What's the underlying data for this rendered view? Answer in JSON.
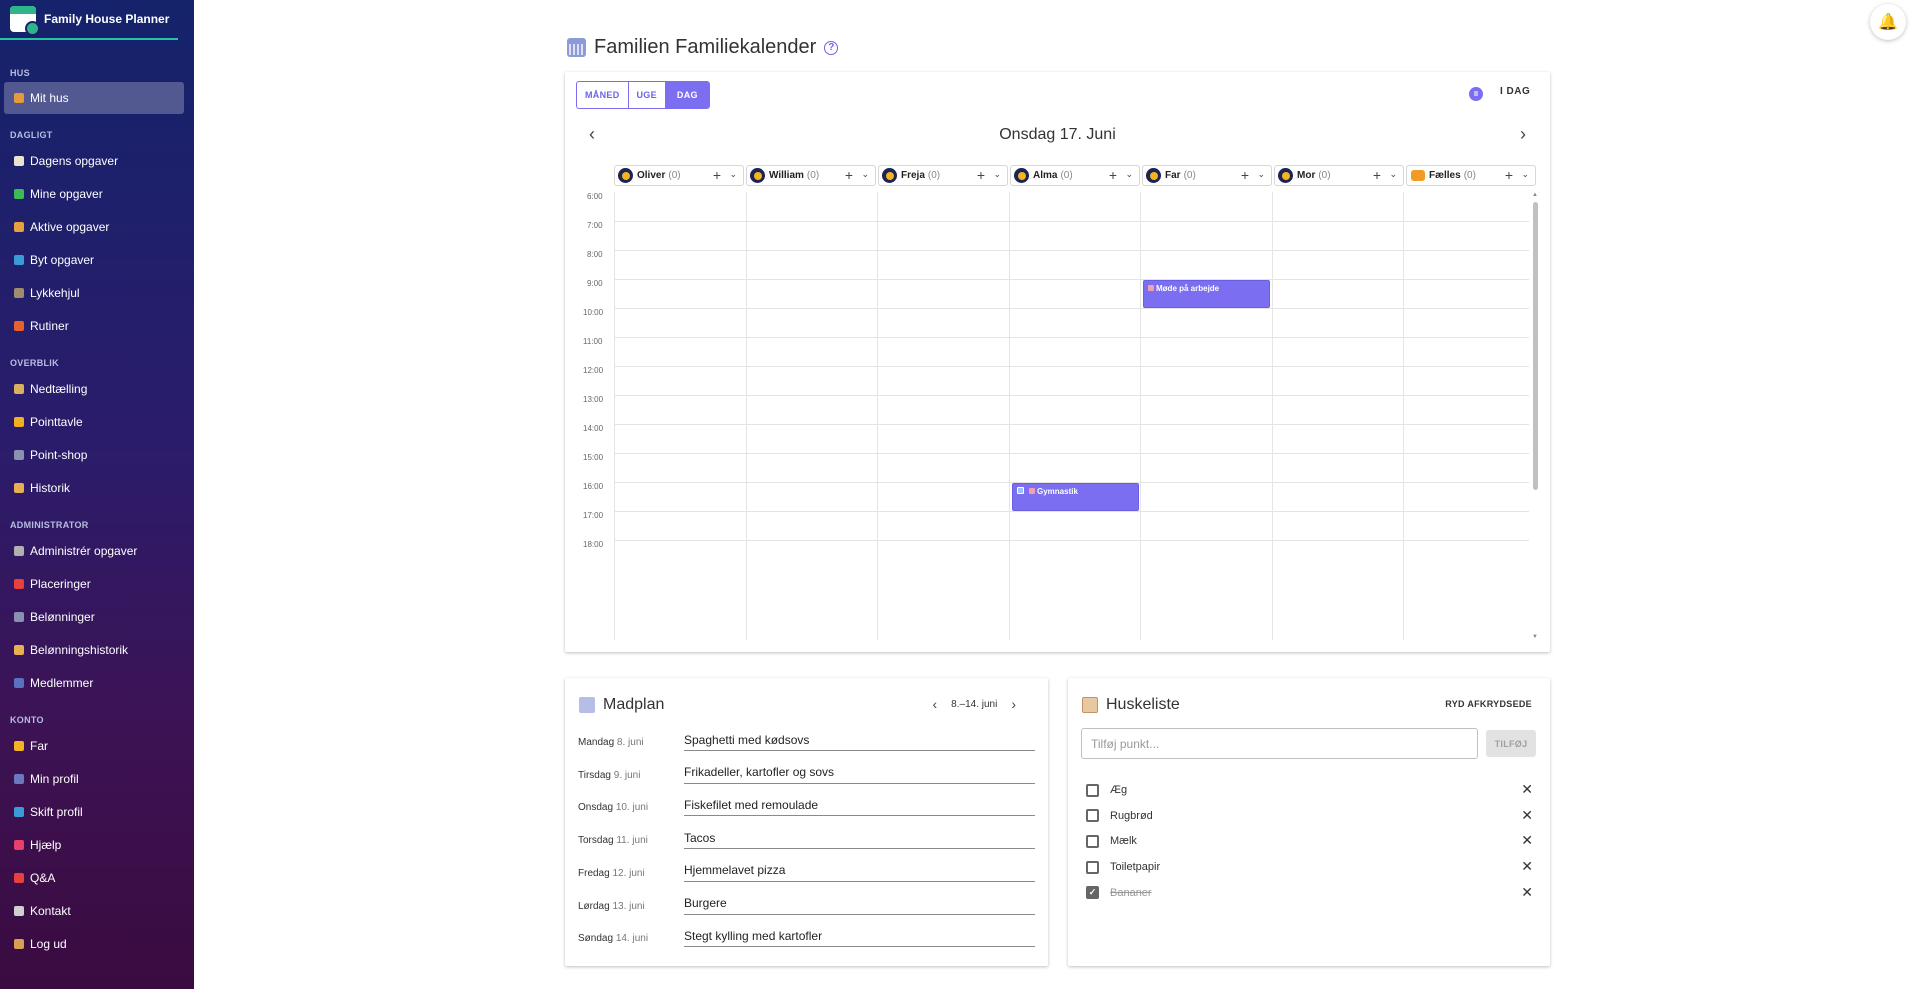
{
  "app": {
    "title": "Family House Planner"
  },
  "sidebar": {
    "sections": [
      {
        "title": "HUS",
        "items": [
          {
            "label": "Mit hus",
            "color": "#e59a3b",
            "active": true
          }
        ]
      },
      {
        "title": "DAGLIGT",
        "items": [
          {
            "label": "Dagens opgaver",
            "color": "#e8e4d0"
          },
          {
            "label": "Mine opgaver",
            "color": "#3cba54"
          },
          {
            "label": "Aktive opgaver",
            "color": "#e8a040"
          },
          {
            "label": "Byt opgaver",
            "color": "#3a9bd8"
          },
          {
            "label": "Lykkehjul",
            "color": "#a08a70"
          },
          {
            "label": "Rutiner",
            "color": "#e8602c"
          }
        ]
      },
      {
        "title": "OVERBLIK",
        "items": [
          {
            "label": "Nedtælling",
            "color": "#d8b060"
          },
          {
            "label": "Pointtavle",
            "color": "#f0b020"
          },
          {
            "label": "Point-shop",
            "color": "#8a90b0"
          },
          {
            "label": "Historik",
            "color": "#e8b050"
          }
        ]
      },
      {
        "title": "ADMINISTRATOR",
        "items": [
          {
            "label": "Administrér opgaver",
            "color": "#b0b0b0"
          },
          {
            "label": "Placeringer",
            "color": "#e84040"
          },
          {
            "label": "Belønninger",
            "color": "#8a90b0"
          },
          {
            "label": "Belønningshistorik",
            "color": "#e8b050"
          },
          {
            "label": "Medlemmer",
            "color": "#5a70c0"
          }
        ]
      },
      {
        "title": "KONTO",
        "items": [
          {
            "label": "Far",
            "color": "#f2b422"
          },
          {
            "label": "Min profil",
            "color": "#6a78c0"
          },
          {
            "label": "Skift profil",
            "color": "#3a9bd8"
          },
          {
            "label": "Hjælp",
            "color": "#e8406a"
          },
          {
            "label": "Q&A",
            "color": "#e84040"
          },
          {
            "label": "Kontakt",
            "color": "#d0d0d0"
          },
          {
            "label": "Log ud",
            "color": "#d8a050"
          }
        ]
      }
    ]
  },
  "calendar": {
    "title": "Familien Familiekalender",
    "views": [
      "MÅNED",
      "UGE",
      "DAG"
    ],
    "active_view": "DAG",
    "today_label": "I DAG",
    "date_label": "Onsdag 17. Juni",
    "people": [
      {
        "name": "Oliver",
        "count": "(0)"
      },
      {
        "name": "William",
        "count": "(0)"
      },
      {
        "name": "Freja",
        "count": "(0)"
      },
      {
        "name": "Alma",
        "count": "(0)"
      },
      {
        "name": "Far",
        "count": "(0)"
      },
      {
        "name": "Mor",
        "count": "(0)"
      },
      {
        "name": "Fælles",
        "count": "(0)",
        "group": true
      }
    ],
    "hours": [
      "6:00",
      "7:00",
      "8:00",
      "9:00",
      "10:00",
      "11:00",
      "12:00",
      "13:00",
      "14:00",
      "15:00",
      "16:00",
      "17:00",
      "18:00"
    ],
    "events": [
      {
        "title": "Møde på arbejde",
        "person": 4,
        "start": 9,
        "end": 10
      },
      {
        "title": "Gymnastik",
        "person": 3,
        "start": 16,
        "end": 17,
        "checkbox": true
      }
    ]
  },
  "mealplan": {
    "title": "Madplan",
    "range": "8.–14. juni",
    "days": [
      {
        "day": "Mandag",
        "date": "8. juni",
        "meal": "Spaghetti med kødsovs"
      },
      {
        "day": "Tirsdag",
        "date": "9. juni",
        "meal": "Frikadeller, kartofler og sovs"
      },
      {
        "day": "Onsdag",
        "date": "10. juni",
        "meal": "Fiskefilet med remoulade"
      },
      {
        "day": "Torsdag",
        "date": "11. juni",
        "meal": "Tacos"
      },
      {
        "day": "Fredag",
        "date": "12. juni",
        "meal": "Hjemmelavet pizza"
      },
      {
        "day": "Lørdag",
        "date": "13. juni",
        "meal": "Burgere"
      },
      {
        "day": "Søndag",
        "date": "14. juni",
        "meal": "Stegt kylling med kartofler"
      }
    ]
  },
  "shopping": {
    "title": "Huskeliste",
    "clear_label": "RYD AFKRYDSEDE",
    "placeholder": "Tilføj punkt...",
    "add_label": "TILFØJ",
    "items": [
      {
        "label": "Æg",
        "checked": false
      },
      {
        "label": "Rugbrød",
        "checked": false
      },
      {
        "label": "Mælk",
        "checked": false
      },
      {
        "label": "Toiletpapir",
        "checked": false
      },
      {
        "label": "Bananer",
        "checked": true
      }
    ]
  },
  "colors": {
    "accent": "#7b6ef0",
    "sidebar_top": "#14236b",
    "sidebar_bottom": "#3a0b40",
    "logo_underline": "#27c1a6"
  }
}
